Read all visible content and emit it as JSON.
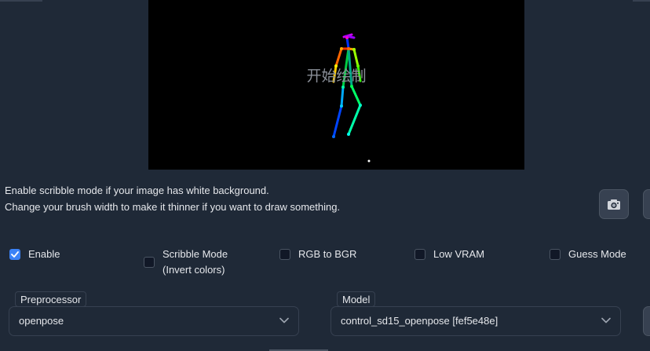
{
  "canvas": {
    "overlay_text": "开始绘制"
  },
  "info": {
    "line1": "Enable scribble mode if your image has white background.",
    "line2": "Change your brush width to make it thinner if you want to draw something."
  },
  "toolbar": {
    "camera_icon": "camera-icon"
  },
  "checkboxes": [
    {
      "label": "Enable",
      "checked": true
    },
    {
      "label": "Scribble Mode\n(Invert colors)",
      "checked": false
    },
    {
      "label": "RGB to BGR",
      "checked": false
    },
    {
      "label": "Low VRAM",
      "checked": false
    },
    {
      "label": "Guess Mode",
      "checked": false
    }
  ],
  "preprocessor": {
    "label": "Preprocessor",
    "value": "openpose"
  },
  "model": {
    "label": "Model",
    "value": "control_sd15_openpose [fef5e48e]"
  },
  "colors": {
    "background": "#1f2937",
    "accent": "#3b82f6",
    "canvas": "#000000"
  }
}
